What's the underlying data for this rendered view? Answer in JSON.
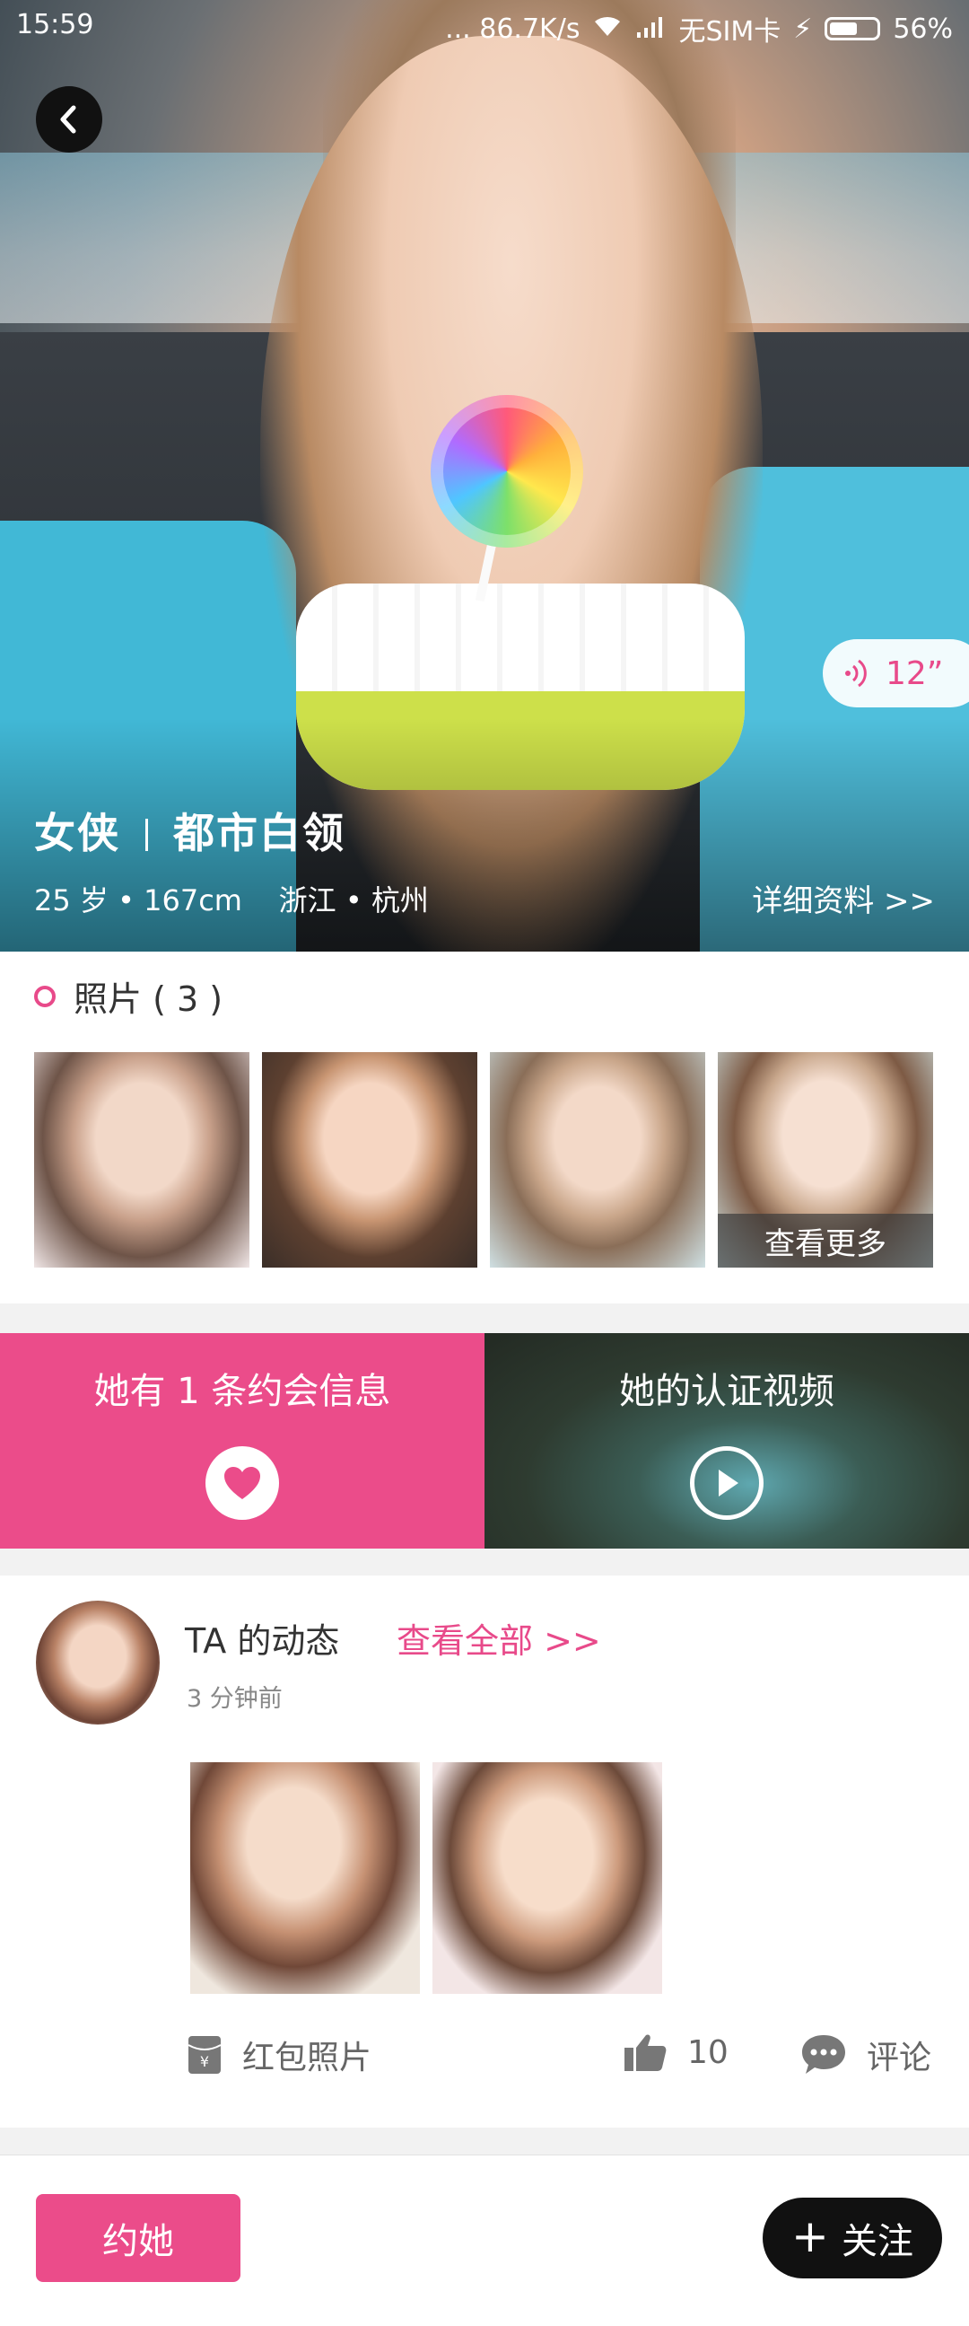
{
  "status_bar": {
    "time": "15:59",
    "network_speed": "... 86.7K/s",
    "carrier": "无SIM卡",
    "battery": "56%"
  },
  "hero": {
    "name": "女侠",
    "occupation": "都市白领",
    "meta": "25 岁 • 167cm    浙江 • 杭州",
    "detail_link": "详细资料 >>",
    "voice_duration": "12”"
  },
  "photos": {
    "title": "照片 ( 3 )",
    "more_label": "查看更多"
  },
  "promo": {
    "date_info": "她有 1 条约会信息",
    "video": "她的认证视频"
  },
  "feed": {
    "title": "TA 的动态",
    "view_all": "查看全部 >>",
    "time": "3 分钟前",
    "red_packet_label": "红包照片",
    "like_count": "10",
    "comment_label": "评论"
  },
  "bottom": {
    "date_button": "约她",
    "follow_button": "关注"
  },
  "colors": {
    "accent": "#eb4c8a",
    "dark": "#111111"
  }
}
